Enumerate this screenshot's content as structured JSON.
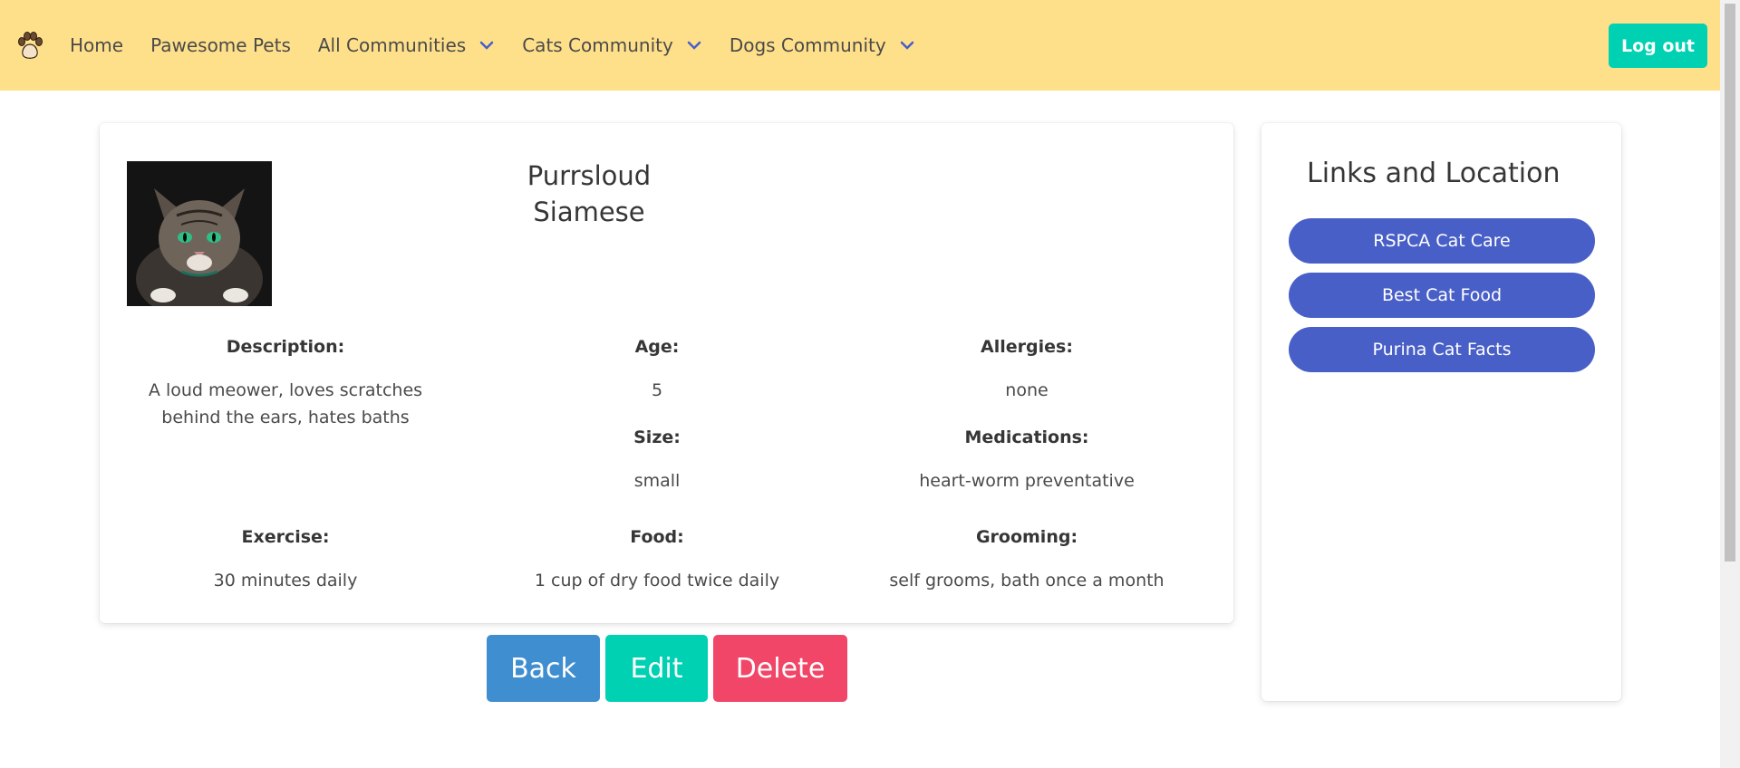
{
  "nav": {
    "logo_icon": "paw-icon",
    "items": [
      {
        "label": "Home",
        "dropdown": false
      },
      {
        "label": "Pawesome Pets",
        "dropdown": false
      },
      {
        "label": "All Communities",
        "dropdown": true
      },
      {
        "label": "Cats Community",
        "dropdown": true
      },
      {
        "label": "Dogs Community",
        "dropdown": true
      }
    ],
    "logout_label": "Log out"
  },
  "pet": {
    "name": "Purrsloud",
    "breed": "Siamese",
    "photo_icon": "cat-photo",
    "fields": {
      "description": {
        "label": "Description:",
        "value": "A loud meower, loves scratches behind the ears, hates baths"
      },
      "age": {
        "label": "Age:",
        "value": "5"
      },
      "allergies": {
        "label": "Allergies:",
        "value": "none"
      },
      "size": {
        "label": "Size:",
        "value": "small"
      },
      "medications": {
        "label": "Medications:",
        "value": "heart-worm preventative"
      },
      "exercise": {
        "label": "Exercise:",
        "value": "30 minutes daily"
      },
      "food": {
        "label": "Food:",
        "value": "1 cup of dry food twice daily"
      },
      "grooming": {
        "label": "Grooming:",
        "value": "self grooms, bath once a month"
      }
    }
  },
  "actions": {
    "back": "Back",
    "edit": "Edit",
    "delete": "Delete"
  },
  "sidebar": {
    "title": "Links and Location",
    "links": [
      "RSPCA Cat Care",
      "Best Cat Food",
      "Purina Cat Facts"
    ]
  },
  "colors": {
    "navbar_bg": "#ffe08a",
    "logout_bg": "#00d1b2",
    "back_bg": "#3e8ed0",
    "edit_bg": "#00d1b2",
    "delete_bg": "#f14668",
    "link_bg": "#485fc7"
  }
}
